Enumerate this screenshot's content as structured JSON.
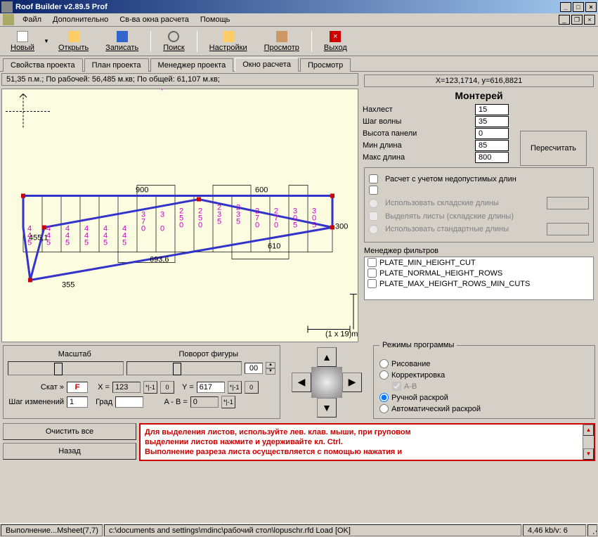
{
  "window": {
    "title": "Roof Builder v2.89.5 Prof"
  },
  "menu": {
    "file": "Файл",
    "additional": "Дополнительно",
    "calc_props": "Св-ва окна расчета",
    "help": "Помощь"
  },
  "toolbar": {
    "new": "Новый",
    "open": "Открыть",
    "save": "Записать",
    "search": "Поиск",
    "settings": "Настройки",
    "view": "Просмотр",
    "exit": "Выход"
  },
  "tabs": {
    "t1": "Свойства проекта",
    "t2": "План проекта",
    "t3": "Менеджер проекта",
    "t4": "Окно расчета",
    "t5": "Просмотр"
  },
  "canvas_status": "51,35 п.м.; По рабочей: 56,485 м.кв; По общей: 61,107 м.кв;",
  "xy_status": "X=123,1714, y=616,8821",
  "params": {
    "title": "Монтерей",
    "overlap_lbl": "Нахлест",
    "overlap_val": "15",
    "wave_lbl": "Шаг волны",
    "wave_val": "35",
    "height_lbl": "Высота панели",
    "height_val": "0",
    "minlen_lbl": "Мин длина",
    "minlen_val": "85",
    "maxlen_lbl": "Макс длина",
    "maxlen_val": "800",
    "recalc": "Пересчитать"
  },
  "options": {
    "bad_lengths": "Расчет с учетом недопустимых длин",
    "use_stock": "Использовать складские длины",
    "highlight": "Выделять листы (складские длины)",
    "use_standard": "Использовать стандартные длины"
  },
  "filters": {
    "label": "Менеджер фильтров",
    "f1": "PLATE_MIN_HEIGHT_CUT",
    "f2": "PLATE_NORMAL_HEIGHT_ROWS",
    "f3": "PLATE_MAX_HEIGHT_ROWS_MIN_CUTS"
  },
  "controls": {
    "scale_lbl": "Масштаб",
    "rotate_lbl": "Поворот фигуры",
    "rotate_val": "00",
    "slope_lbl": "Скат »",
    "slope_val": "F",
    "x_lbl": "X =",
    "x_val": "123",
    "y_lbl": "Y =",
    "y_val": "617",
    "step_lbl": "Шаг изменений",
    "step_val": "1",
    "grad_lbl": "Град",
    "grad_val": "",
    "ab_lbl": "A - B =",
    "ab_val": "0",
    "btn_m1": "*|-1",
    "btn_0": "0",
    "btn_p1": "*|-1"
  },
  "modes": {
    "title": "Режимы программы",
    "draw": "Рисование",
    "correct": "Корректировка",
    "ab": "A-B",
    "manual": "Ручной раскрой",
    "auto": "Автоматический раскрой"
  },
  "actions": {
    "clear": "Очистить все",
    "back": "Назад"
  },
  "message": {
    "l1": "Для выделения листов, используйте лев. клав. мыши, при груповом",
    "l2": "выделении листов нажмите и удерживайте кл. Ctrl.",
    "l3": "Выполнение разреза листа осуществляется с помощью нажатия и"
  },
  "statusbar": {
    "s1": "Выполнение...Msheet(7,7)",
    "s2": "c:\\documents and settings\\mdinc\\рабочий стол\\lopuschr.rfd Load [OK]",
    "s3": "4,46 kb/v: 6"
  },
  "roof": {
    "dim_900": "900",
    "dim_600": "600",
    "dim_300": "300",
    "dim_693": "693,6",
    "dim_610": "610",
    "dim_455": "455,1",
    "dim_355": "355",
    "scale": "(1 x 19)m",
    "labels": [
      "4 4 5",
      "4 4 5",
      "4 4 5",
      "4 4 5",
      "4 4 5",
      "4 4 5",
      "3 7 0",
      "3 7 0",
      "2 5 0",
      "2 5 0",
      "2 3 5",
      "2 3 5",
      "2 7 0",
      "2 7 0",
      "3 0 5",
      "3 0 5"
    ]
  }
}
